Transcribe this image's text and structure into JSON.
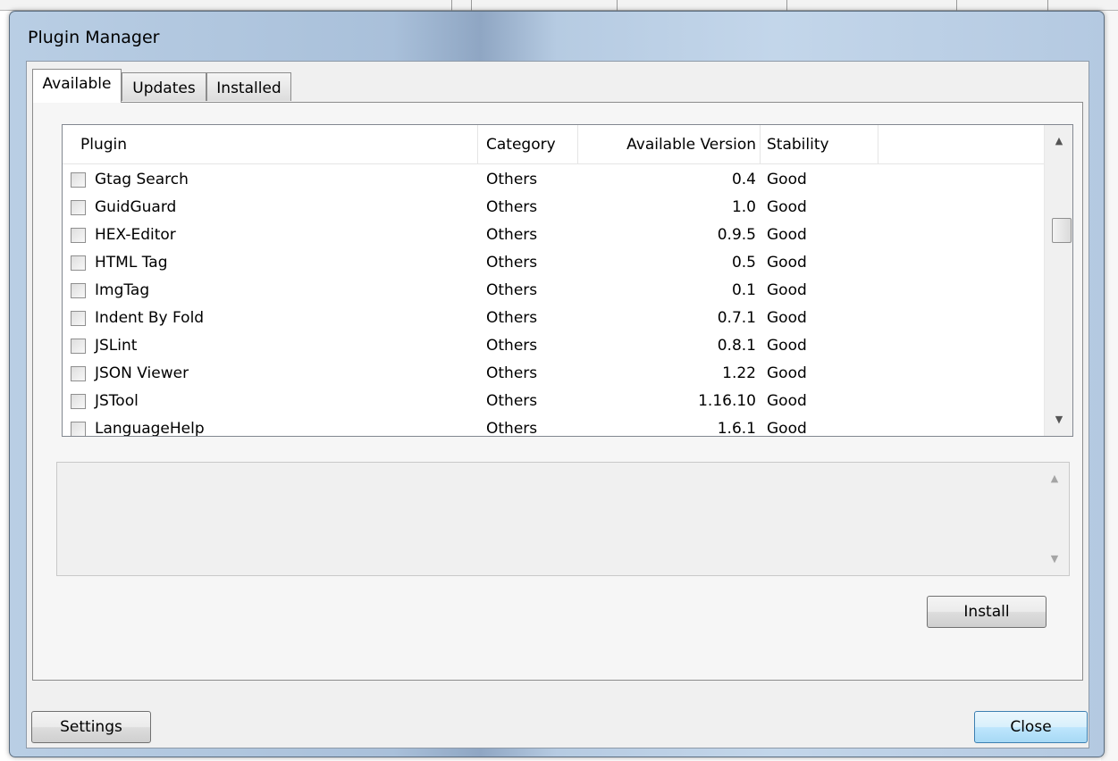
{
  "window": {
    "title": "Plugin Manager"
  },
  "tabs": [
    {
      "label": "Available",
      "active": true
    },
    {
      "label": "Updates",
      "active": false
    },
    {
      "label": "Installed",
      "active": false
    }
  ],
  "list": {
    "columns": [
      "Plugin",
      "Category",
      "Available Version",
      "Stability"
    ],
    "rows": [
      {
        "name": "Gtag Search",
        "category": "Others",
        "version": "0.4",
        "stability": "Good",
        "checked": false
      },
      {
        "name": "GuidGuard",
        "category": "Others",
        "version": "1.0",
        "stability": "Good",
        "checked": false
      },
      {
        "name": "HEX-Editor",
        "category": "Others",
        "version": "0.9.5",
        "stability": "Good",
        "checked": false
      },
      {
        "name": "HTML Tag",
        "category": "Others",
        "version": "0.5",
        "stability": "Good",
        "checked": false
      },
      {
        "name": "ImgTag",
        "category": "Others",
        "version": "0.1",
        "stability": "Good",
        "checked": false
      },
      {
        "name": "Indent By Fold",
        "category": "Others",
        "version": "0.7.1",
        "stability": "Good",
        "checked": false
      },
      {
        "name": "JSLint",
        "category": "Others",
        "version": "0.8.1",
        "stability": "Good",
        "checked": false
      },
      {
        "name": "JSON Viewer",
        "category": "Others",
        "version": "1.22",
        "stability": "Good",
        "checked": false
      },
      {
        "name": "JSTool",
        "category": "Others",
        "version": "1.16.10",
        "stability": "Good",
        "checked": false
      },
      {
        "name": "LanguageHelp",
        "category": "Others",
        "version": "1.6.1",
        "stability": "Good",
        "checked": false
      }
    ]
  },
  "buttons": {
    "install": "Install",
    "settings": "Settings",
    "close": "Close"
  },
  "icons": {
    "scroll_up": "up-arrow",
    "scroll_down": "down-arrow"
  },
  "colors": {
    "title_bar": "#b9cee4",
    "default_button": "#bee6fd"
  }
}
